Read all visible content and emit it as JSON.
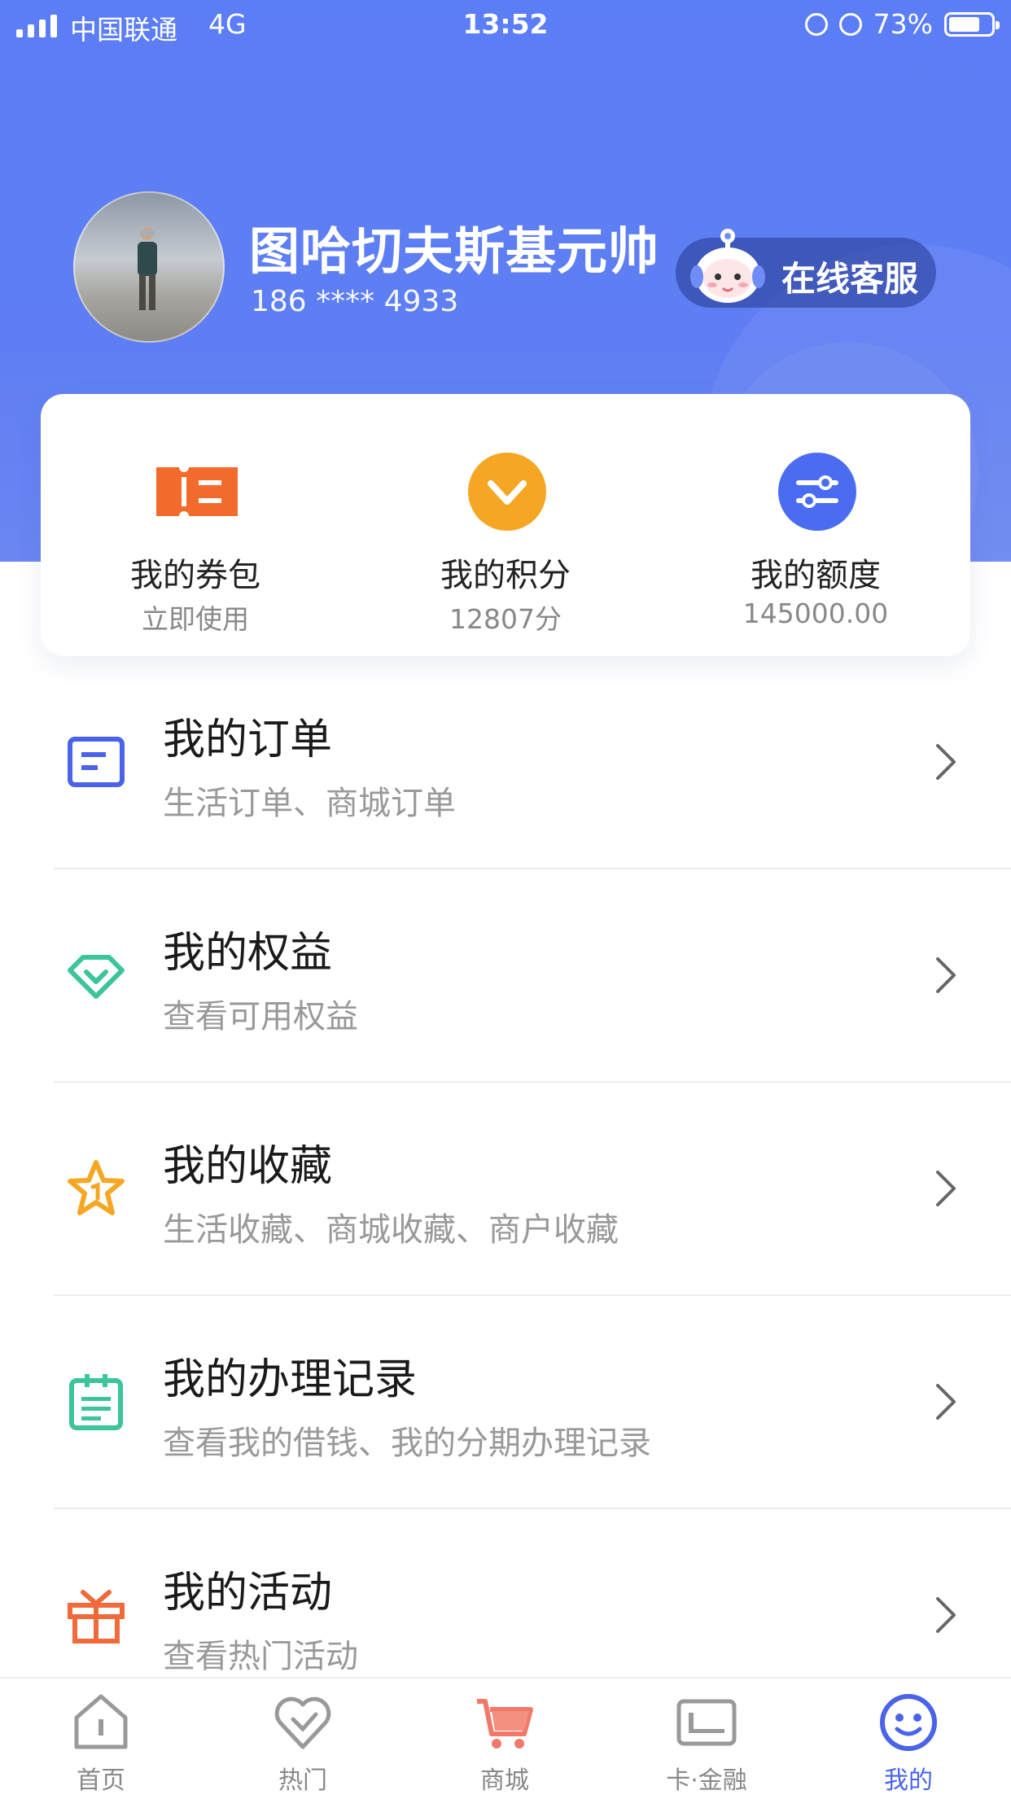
{
  "status_bar": {
    "carrier": "中国联通",
    "network": "4G",
    "time": "13:52",
    "battery": "73%",
    "battery_level": 0.73
  },
  "profile": {
    "name": "图哈切夫斯基元帅",
    "phone": "186 **** 4933",
    "service_label": "在线客服"
  },
  "quick_actions": [
    {
      "title": "我的券包",
      "sub": "立即使用",
      "icon": "coupon-icon",
      "color": "#f26a2c"
    },
    {
      "title": "我的积分",
      "sub": "12807分",
      "icon": "points-icon",
      "color": "#f5a623"
    },
    {
      "title": "我的额度",
      "sub": "145000.00",
      "icon": "credit-limit-icon",
      "color": "#4a6cf0"
    }
  ],
  "menu": [
    {
      "title": "我的订单",
      "sub": "生活订单、商城订单",
      "icon": "order-icon",
      "color": "#4a63e8"
    },
    {
      "title": "我的权益",
      "sub": "查看可用权益",
      "icon": "diamond-icon",
      "color": "#3cc59a"
    },
    {
      "title": "我的收藏",
      "sub": "生活收藏、商城收藏、商户收藏",
      "icon": "star-icon",
      "color": "#f5a623"
    },
    {
      "title": "我的办理记录",
      "sub": "查看我的借钱、我的分期办理记录",
      "icon": "record-icon",
      "color": "#3cc59a"
    },
    {
      "title": "我的活动",
      "sub": "查看热门活动",
      "icon": "gift-icon",
      "color": "#f06a3a"
    }
  ],
  "tabs": [
    {
      "label": "首页",
      "icon": "home-icon",
      "active": false
    },
    {
      "label": "热门",
      "icon": "heart-icon",
      "active": false
    },
    {
      "label": "商城",
      "icon": "cart-icon",
      "active": false
    },
    {
      "label": "卡·金融",
      "icon": "card-icon",
      "active": false
    },
    {
      "label": "我的",
      "icon": "smile-icon",
      "active": true
    }
  ],
  "colors": {
    "hero": "#5b7df5",
    "active_tab": "#4a63e8"
  }
}
